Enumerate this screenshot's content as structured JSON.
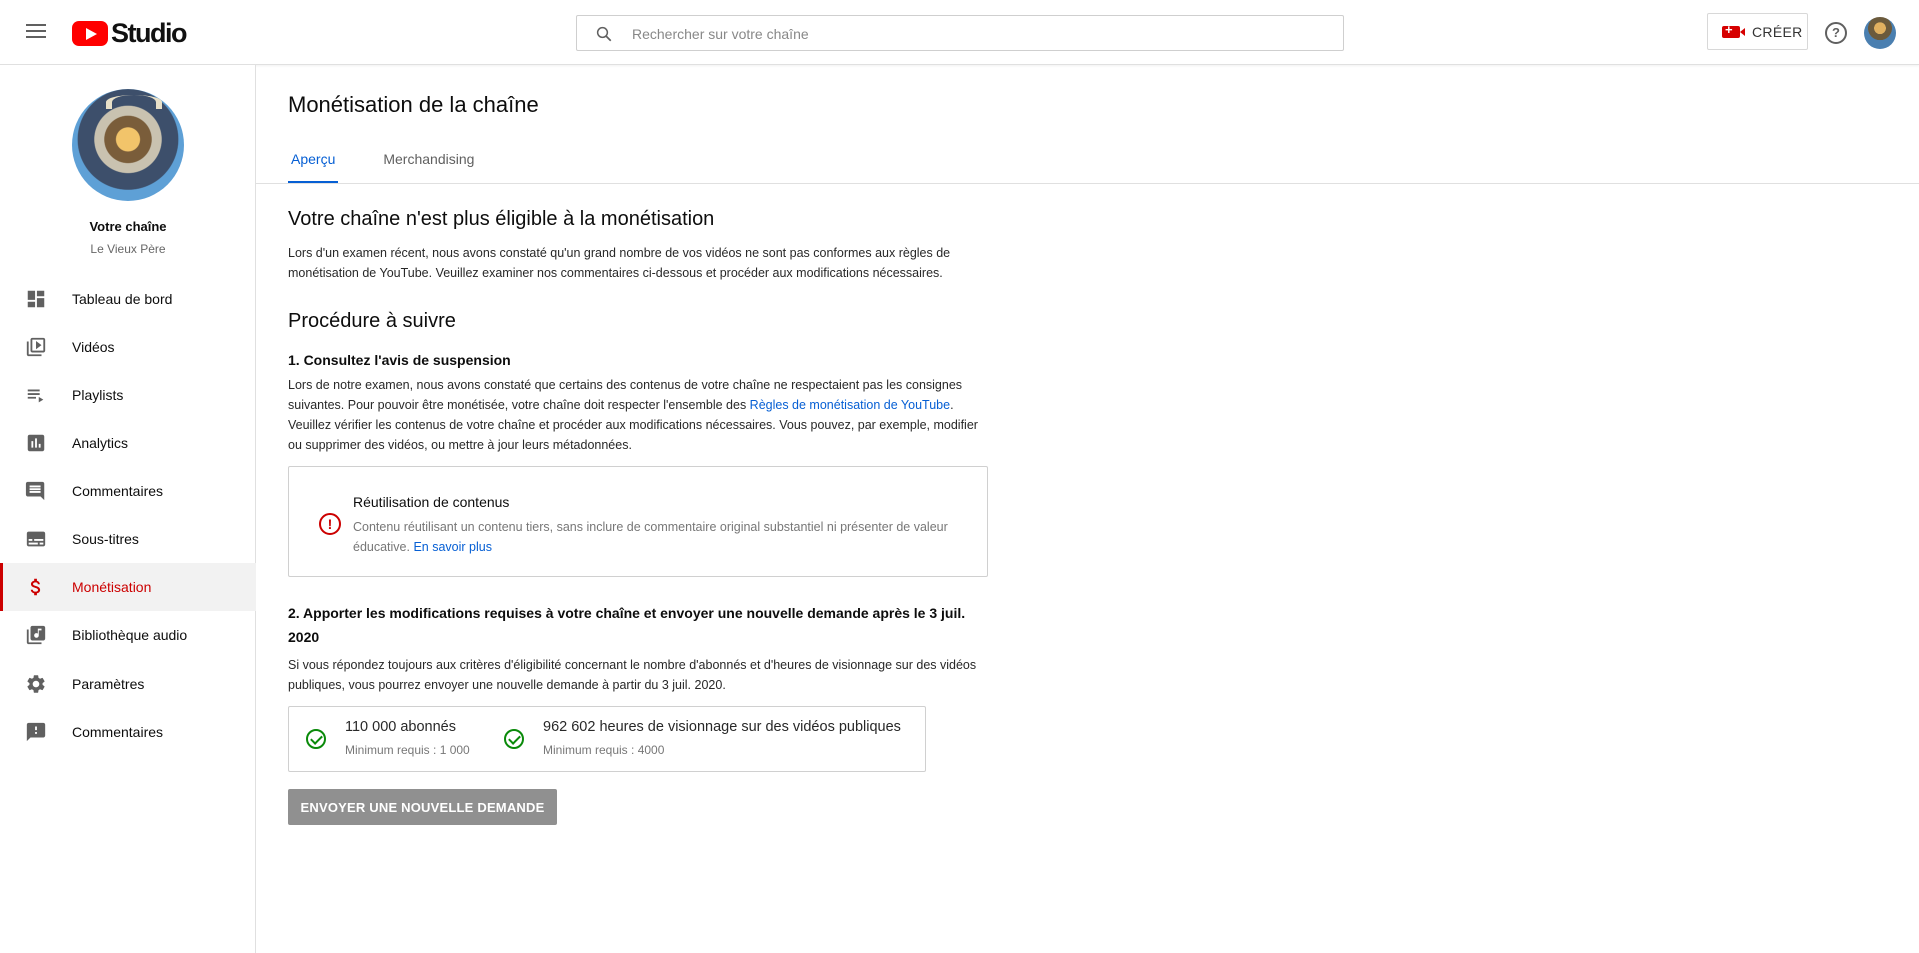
{
  "header": {
    "logo_text": "Studio",
    "search_placeholder": "Rechercher sur votre chaîne",
    "create_label": "CRÉER",
    "help_glyph": "?"
  },
  "sidebar": {
    "channel_label": "Votre chaîne",
    "channel_name": "Le Vieux Père",
    "items": [
      {
        "label": "Tableau de bord",
        "icon": "dashboard-icon"
      },
      {
        "label": "Vidéos",
        "icon": "videos-icon"
      },
      {
        "label": "Playlists",
        "icon": "playlists-icon"
      },
      {
        "label": "Analytics",
        "icon": "analytics-icon"
      },
      {
        "label": "Commentaires",
        "icon": "comments-icon"
      },
      {
        "label": "Sous-titres",
        "icon": "subtitles-icon"
      },
      {
        "label": "Monétisation",
        "icon": "dollar-icon",
        "active": true
      },
      {
        "label": "Bibliothèque audio",
        "icon": "audio-library-icon"
      }
    ],
    "bottom_items": [
      {
        "label": "Paramètres",
        "icon": "gear-icon"
      },
      {
        "label": "Commentaires",
        "icon": "feedback-icon"
      }
    ]
  },
  "main": {
    "title": "Monétisation de la chaîne",
    "tabs": [
      {
        "label": "Aperçu",
        "active": true
      },
      {
        "label": "Merchandising",
        "active": false
      }
    ],
    "heading": "Votre chaîne n'est plus éligible à la monétisation",
    "intro": "Lors d'un examen récent, nous avons constaté qu'un grand nombre de vos vidéos ne sont pas conformes aux règles de monétisation de YouTube. Veuillez examiner nos commentaires ci-dessous et procéder aux modifications nécessaires.",
    "procedure_heading": "Procédure à suivre",
    "step1": {
      "title": "1. Consultez l'avis de suspension",
      "text_before_link": "Lors de notre examen, nous avons constaté que certains des contenus de votre chaîne ne respectaient pas les consignes suivantes. Pour pouvoir être monétisée, votre chaîne doit respecter l'ensemble des ",
      "link": "Règles de monétisation de YouTube",
      "text_after_link": ". Veuillez vérifier les contenus de votre chaîne et procéder aux modifications nécessaires. Vous pouvez, par exemple, modifier ou supprimer des vidéos, ou mettre à jour leurs métadonnées."
    },
    "violation": {
      "glyph": "!",
      "title": "Réutilisation de contenus",
      "text": "Contenu réutilisant un contenu tiers, sans inclure de commentaire original substantiel ni présenter de valeur éducative. ",
      "link": "En savoir plus"
    },
    "step2": {
      "title": "2. Apporter les modifications requises à votre chaîne et envoyer une nouvelle demande après le 3 juil. 2020",
      "text": "Si vous répondez toujours aux critères d'éligibilité concernant le nombre d'abonnés et d'heures de visionnage sur des vidéos publiques, vous pourrez envoyer une nouvelle demande à partir du 3 juil. 2020."
    },
    "stats": [
      {
        "value": "110 000 abonnés",
        "minimum": "Minimum requis : 1 000"
      },
      {
        "value": "962 602 heures de visionnage sur des vidéos publiques",
        "minimum": "Minimum requis : 4000"
      }
    ],
    "submit_label": "ENVOYER UNE NOUVELLE DEMANDE"
  },
  "colors": {
    "accent": "#065fd4",
    "active_red": "#cc0000",
    "success_green": "#0a8a0a",
    "disabled_button": "#909090"
  }
}
